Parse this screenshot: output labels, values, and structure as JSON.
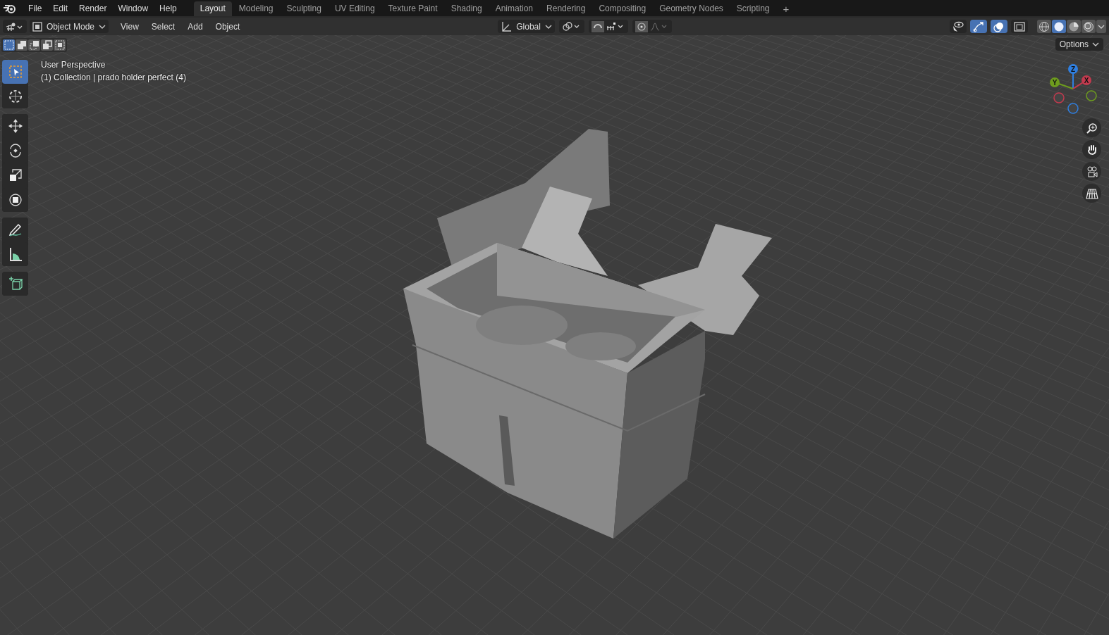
{
  "menu": [
    "File",
    "Edit",
    "Render",
    "Window",
    "Help"
  ],
  "workspaces": [
    {
      "label": "Layout",
      "selected": true
    },
    {
      "label": "Modeling",
      "selected": false
    },
    {
      "label": "Sculpting",
      "selected": false
    },
    {
      "label": "UV Editing",
      "selected": false
    },
    {
      "label": "Texture Paint",
      "selected": false
    },
    {
      "label": "Shading",
      "selected": false
    },
    {
      "label": "Animation",
      "selected": false
    },
    {
      "label": "Rendering",
      "selected": false
    },
    {
      "label": "Compositing",
      "selected": false
    },
    {
      "label": "Geometry Nodes",
      "selected": false
    },
    {
      "label": "Scripting",
      "selected": false
    }
  ],
  "add_workspace": "+",
  "header": {
    "mode": "Object Mode",
    "menus": [
      "View",
      "Select",
      "Add",
      "Object"
    ],
    "orientation": "Global",
    "toggles": [
      {
        "kind": "visibility",
        "selected": false
      },
      {
        "kind": "gizmo",
        "selected": true
      },
      {
        "kind": "overlay",
        "selected": true
      },
      {
        "kind": "xray",
        "selected": false
      }
    ],
    "shading": [
      {
        "kind": "wireframe",
        "selected": false
      },
      {
        "kind": "solid",
        "selected": true
      },
      {
        "kind": "material",
        "selected": false
      },
      {
        "kind": "rendered",
        "selected": false
      }
    ]
  },
  "select_modes": [
    {
      "kind": "new",
      "selected": true
    },
    {
      "kind": "extend",
      "selected": false
    },
    {
      "kind": "subtract",
      "selected": false
    },
    {
      "kind": "invert",
      "selected": false
    },
    {
      "kind": "intersect",
      "selected": false
    }
  ],
  "options": "Options",
  "overlay_text": [
    "User Perspective",
    "(1) Collection | prado holder perfect (4)"
  ],
  "tool_groups": [
    [
      {
        "kind": "select",
        "selected": true
      },
      {
        "kind": "cursor",
        "selected": false
      }
    ],
    [
      {
        "kind": "move",
        "selected": false
      },
      {
        "kind": "rotate",
        "selected": false
      },
      {
        "kind": "scale",
        "selected": false
      },
      {
        "kind": "transform",
        "selected": false
      }
    ],
    [
      {
        "kind": "annotate",
        "selected": false
      },
      {
        "kind": "measure",
        "selected": false
      }
    ],
    [
      {
        "kind": "add-cube",
        "selected": false
      }
    ]
  ],
  "axes": [
    {
      "label": "Z",
      "color": "#2f7fe0"
    },
    {
      "label": "Y",
      "color": "#6e9c1e"
    },
    {
      "label": "X",
      "color": "#c23a4e"
    }
  ],
  "nav_buttons": [
    {
      "kind": "zoom"
    },
    {
      "kind": "pan"
    },
    {
      "kind": "camera"
    },
    {
      "kind": "ortho"
    }
  ]
}
